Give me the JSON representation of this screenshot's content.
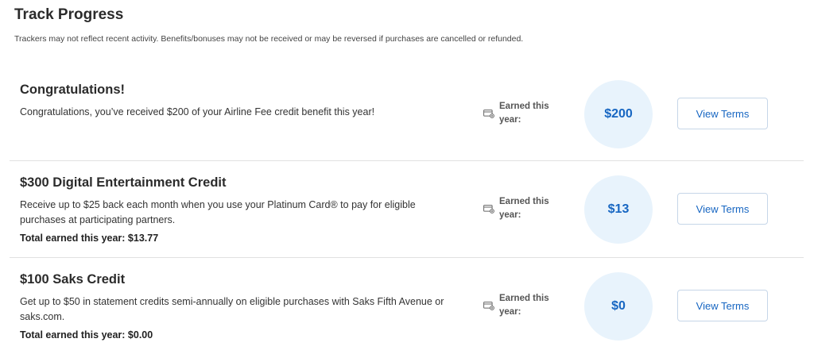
{
  "header": {
    "title": "Track Progress",
    "disclaimer": "Trackers may not reflect recent activity. Benefits/bonuses may not be received or may be reversed if purchases are cancelled or refunded."
  },
  "trackers": [
    {
      "title": "Congratulations!",
      "description": "Congratulations, you’ve received $200 of your Airline Fee credit benefit this year!",
      "total": "",
      "earned_label": "Earned this year:",
      "earned_icon": "card-icon",
      "amount": "$200",
      "button_label": "View Terms"
    },
    {
      "title": "$300 Digital Entertainment Credit",
      "description": "Receive up to $25 back each month when you use your Platinum Card® to pay for eligible purchases at participating partners.",
      "total": "Total earned this year: $13.77",
      "earned_label": "Earned this year:",
      "earned_icon": "card-icon",
      "amount": "$13",
      "button_label": "View Terms"
    },
    {
      "title": "$100 Saks Credit",
      "description": "Get up to $50 in statement credits semi-annually on eligible purchases with Saks Fifth Avenue or saks.com.",
      "total": "Total earned this year: $0.00",
      "earned_label": "Earned this year:",
      "earned_icon": "card-icon",
      "amount": "$0",
      "button_label": "View Terms"
    }
  ],
  "colors": {
    "accent": "#1766c2",
    "circle_bg": "#e8f3fc",
    "button_border": "#c6d6e8",
    "divider": "#e1e1e1"
  }
}
